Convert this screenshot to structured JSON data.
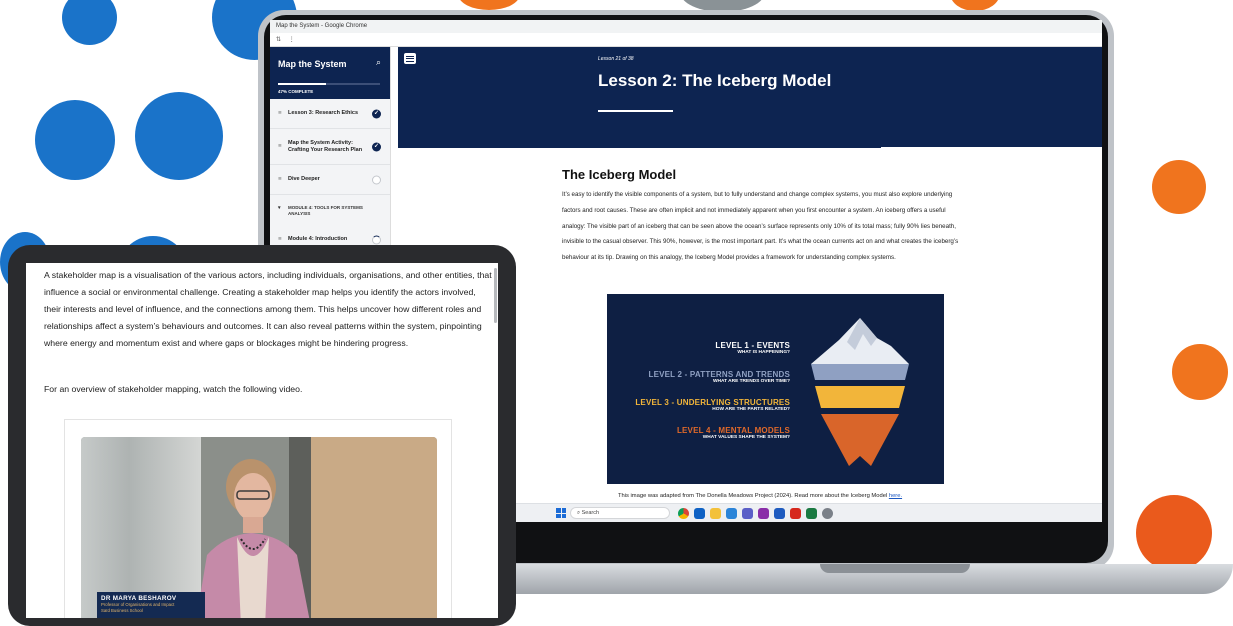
{
  "browser": {
    "window_title": "Map the System - Google Chrome",
    "address_icons": [
      "tune-icon",
      "more-icon"
    ]
  },
  "sidebar": {
    "title": "Map the System",
    "progress_text": "47% COMPLETE",
    "progress_fraction": 0.47,
    "items": [
      {
        "label": "Lesson 3: Research Ethics",
        "status": "complete"
      },
      {
        "label": "Map the System Activity: Crafting Your Research Plan",
        "status": "complete"
      },
      {
        "label": "Dive Deeper",
        "status": "not-started"
      }
    ],
    "module": {
      "label": "MODULE 4: TOOLS FOR SYSTEMS ANALYSIS"
    },
    "module_items": [
      {
        "label": "Module 4: Introduction",
        "status": "in-progress"
      }
    ]
  },
  "lesson": {
    "count": "Lesson 21 of 38",
    "title": "Lesson 2: The Iceberg Model"
  },
  "content": {
    "heading": "The Iceberg Model",
    "paragraph": "It’s easy to identify the visible components of a system, but to fully understand and change complex systems, you must also explore underlying factors and root causes. These are often implicit and not immediately apparent when you first encounter a system. An iceberg offers a useful analogy: The visible part of an iceberg that can be seen above the ocean’s surface represents only 10% of its total mass; fully 90% lies beneath, invisible to the casual observer. This 90%, however, is the most important part. It’s what the ocean currents act on and what creates the iceberg’s behaviour at its tip. Drawing on this analogy, the Iceberg Model provides a framework for understanding complex systems.",
    "caption": "This image was adapted from The Donella Meadows Project (2024). Read more about the Iceberg Model",
    "caption_link": "here."
  },
  "iceberg": {
    "levels": [
      {
        "heading": "LEVEL 1 - EVENTS",
        "sub": "WHAT IS HAPPENING?",
        "color": "#ffffff"
      },
      {
        "heading": "LEVEL 2 - PATTERNS AND TRENDS",
        "sub": "WHAT ARE TRENDS OVER TIME?",
        "color": "#8fa0c2"
      },
      {
        "heading": "LEVEL 3 - UNDERLYING STRUCTURES",
        "sub": "HOW ARE THE PARTS RELATED?",
        "color": "#f2b53a"
      },
      {
        "heading": "LEVEL 4 - MENTAL MODELS",
        "sub": "WHAT VALUES SHAPE THE SYSTEM?",
        "color": "#e0692a"
      }
    ]
  },
  "taskbar": {
    "search_placeholder": "Search"
  },
  "tablet": {
    "paragraph": "A stakeholder map is a visualisation of the various actors, including individuals, organisations, and other entities, that influence a social or environmental challenge. Creating a stakeholder map helps you identify the actors involved, their interests and level of influence, and the connections among them. This helps uncover how different roles and relationships affect a system’s behaviours and outcomes. It can also reveal patterns within the system, pinpointing where energy and momentum exist and where gaps or blockages might be hindering progress.",
    "paragraph2": "For an overview of stakeholder mapping, watch the following video.",
    "video_name": "DR MARYA BESHAROV",
    "video_role": "Professor of Organisations and Impact",
    "video_org": "Saïd Business School"
  },
  "colors": {
    "navy": "#0d2451",
    "dot_blue": "#1a73c9",
    "dot_orange": "#f0741e"
  }
}
